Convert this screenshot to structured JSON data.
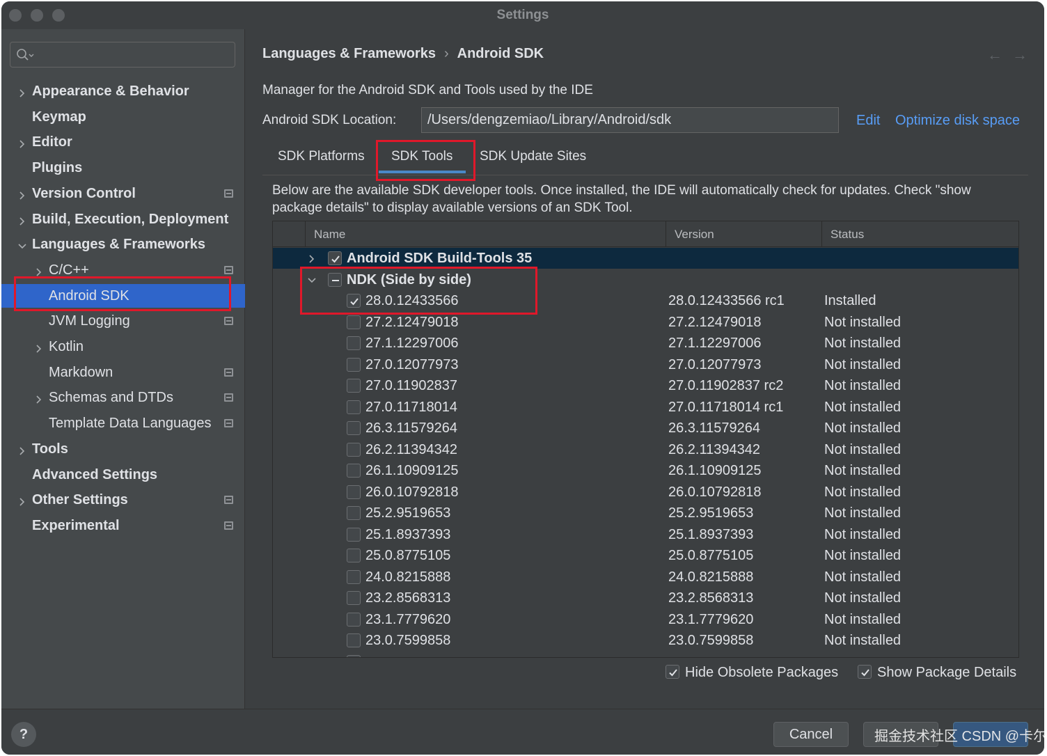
{
  "window": {
    "title": "Settings"
  },
  "sidebar": {
    "search_placeholder": "",
    "items": [
      {
        "label": "Appearance & Behavior",
        "bold": true,
        "chevron": "right",
        "indent": 0,
        "project_icon": false
      },
      {
        "label": "Keymap",
        "bold": true,
        "chevron": "none",
        "indent": 0,
        "project_icon": false
      },
      {
        "label": "Editor",
        "bold": true,
        "chevron": "right",
        "indent": 0,
        "project_icon": false
      },
      {
        "label": "Plugins",
        "bold": true,
        "chevron": "none",
        "indent": 0,
        "project_icon": false
      },
      {
        "label": "Version Control",
        "bold": true,
        "chevron": "right",
        "indent": 0,
        "project_icon": true
      },
      {
        "label": "Build, Execution, Deployment",
        "bold": true,
        "chevron": "right",
        "indent": 0,
        "project_icon": false
      },
      {
        "label": "Languages & Frameworks",
        "bold": true,
        "chevron": "down",
        "indent": 0,
        "project_icon": false
      },
      {
        "label": "C/C++",
        "bold": false,
        "chevron": "right",
        "indent": 1,
        "project_icon": true
      },
      {
        "label": "Android SDK",
        "bold": false,
        "chevron": "none",
        "indent": 1,
        "project_icon": false,
        "selected": true
      },
      {
        "label": "JVM Logging",
        "bold": false,
        "chevron": "none",
        "indent": 1,
        "project_icon": true
      },
      {
        "label": "Kotlin",
        "bold": false,
        "chevron": "right",
        "indent": 1,
        "project_icon": false
      },
      {
        "label": "Markdown",
        "bold": false,
        "chevron": "none",
        "indent": 1,
        "project_icon": true
      },
      {
        "label": "Schemas and DTDs",
        "bold": false,
        "chevron": "right",
        "indent": 1,
        "project_icon": true
      },
      {
        "label": "Template Data Languages",
        "bold": false,
        "chevron": "none",
        "indent": 1,
        "project_icon": true
      },
      {
        "label": "Tools",
        "bold": true,
        "chevron": "right",
        "indent": 0,
        "project_icon": false
      },
      {
        "label": "Advanced Settings",
        "bold": true,
        "chevron": "none",
        "indent": 0,
        "project_icon": false
      },
      {
        "label": "Other Settings",
        "bold": true,
        "chevron": "right",
        "indent": 0,
        "project_icon": true
      },
      {
        "label": "Experimental",
        "bold": true,
        "chevron": "none",
        "indent": 0,
        "project_icon": true
      }
    ]
  },
  "main": {
    "breadcrumb": [
      "Languages & Frameworks",
      "Android SDK"
    ],
    "breadcrumb_sep": "›",
    "description": "Manager for the Android SDK and Tools used by the IDE",
    "location_label": "Android SDK Location:",
    "location_value": "/Users/dengzemiao/Library/Android/sdk",
    "edit_link": "Edit",
    "optimize_link": "Optimize disk space",
    "tabs": [
      "SDK Platforms",
      "SDK Tools",
      "SDK Update Sites"
    ],
    "active_tab": 1,
    "info_text": "Below are the available SDK developer tools. Once installed, the IDE will automatically check for updates. Check \"show package details\" to display available versions of an SDK Tool.",
    "table": {
      "columns": [
        "Name",
        "Version",
        "Status"
      ],
      "groups": [
        {
          "name": "Android SDK Build-Tools 35",
          "expanded": false,
          "state": "checked"
        },
        {
          "name": "NDK (Side by side)",
          "expanded": true,
          "state": "partial"
        }
      ],
      "rows": [
        {
          "name": "28.0.12433566",
          "version": "28.0.12433566 rc1",
          "status": "Installed",
          "checked": true
        },
        {
          "name": "27.2.12479018",
          "version": "27.2.12479018",
          "status": "Not installed",
          "checked": false
        },
        {
          "name": "27.1.12297006",
          "version": "27.1.12297006",
          "status": "Not installed",
          "checked": false
        },
        {
          "name": "27.0.12077973",
          "version": "27.0.12077973",
          "status": "Not installed",
          "checked": false
        },
        {
          "name": "27.0.11902837",
          "version": "27.0.11902837 rc2",
          "status": "Not installed",
          "checked": false
        },
        {
          "name": "27.0.11718014",
          "version": "27.0.11718014 rc1",
          "status": "Not installed",
          "checked": false
        },
        {
          "name": "26.3.11579264",
          "version": "26.3.11579264",
          "status": "Not installed",
          "checked": false
        },
        {
          "name": "26.2.11394342",
          "version": "26.2.11394342",
          "status": "Not installed",
          "checked": false
        },
        {
          "name": "26.1.10909125",
          "version": "26.1.10909125",
          "status": "Not installed",
          "checked": false
        },
        {
          "name": "26.0.10792818",
          "version": "26.0.10792818",
          "status": "Not installed",
          "checked": false
        },
        {
          "name": "25.2.9519653",
          "version": "25.2.9519653",
          "status": "Not installed",
          "checked": false
        },
        {
          "name": "25.1.8937393",
          "version": "25.1.8937393",
          "status": "Not installed",
          "checked": false
        },
        {
          "name": "25.0.8775105",
          "version": "25.0.8775105",
          "status": "Not installed",
          "checked": false
        },
        {
          "name": "24.0.8215888",
          "version": "24.0.8215888",
          "status": "Not installed",
          "checked": false
        },
        {
          "name": "23.2.8568313",
          "version": "23.2.8568313",
          "status": "Not installed",
          "checked": false
        },
        {
          "name": "23.1.7779620",
          "version": "23.1.7779620",
          "status": "Not installed",
          "checked": false
        },
        {
          "name": "23.0.7599858",
          "version": "23.0.7599858",
          "status": "Not installed",
          "checked": false
        }
      ]
    },
    "hide_obsolete": {
      "label": "Hide Obsolete Packages",
      "checked": true
    },
    "show_details": {
      "label": "Show Package Details",
      "checked": true
    }
  },
  "footer": {
    "help": "?",
    "cancel": "Cancel",
    "apply": "",
    "ok": "",
    "watermark": "掘金技术社区 CSDN @卡尔特斯"
  },
  "colors": {
    "selected": "#2f65ca",
    "link": "#589df6",
    "annotation": "#e0182a",
    "row_highlight": "#0d293e"
  }
}
